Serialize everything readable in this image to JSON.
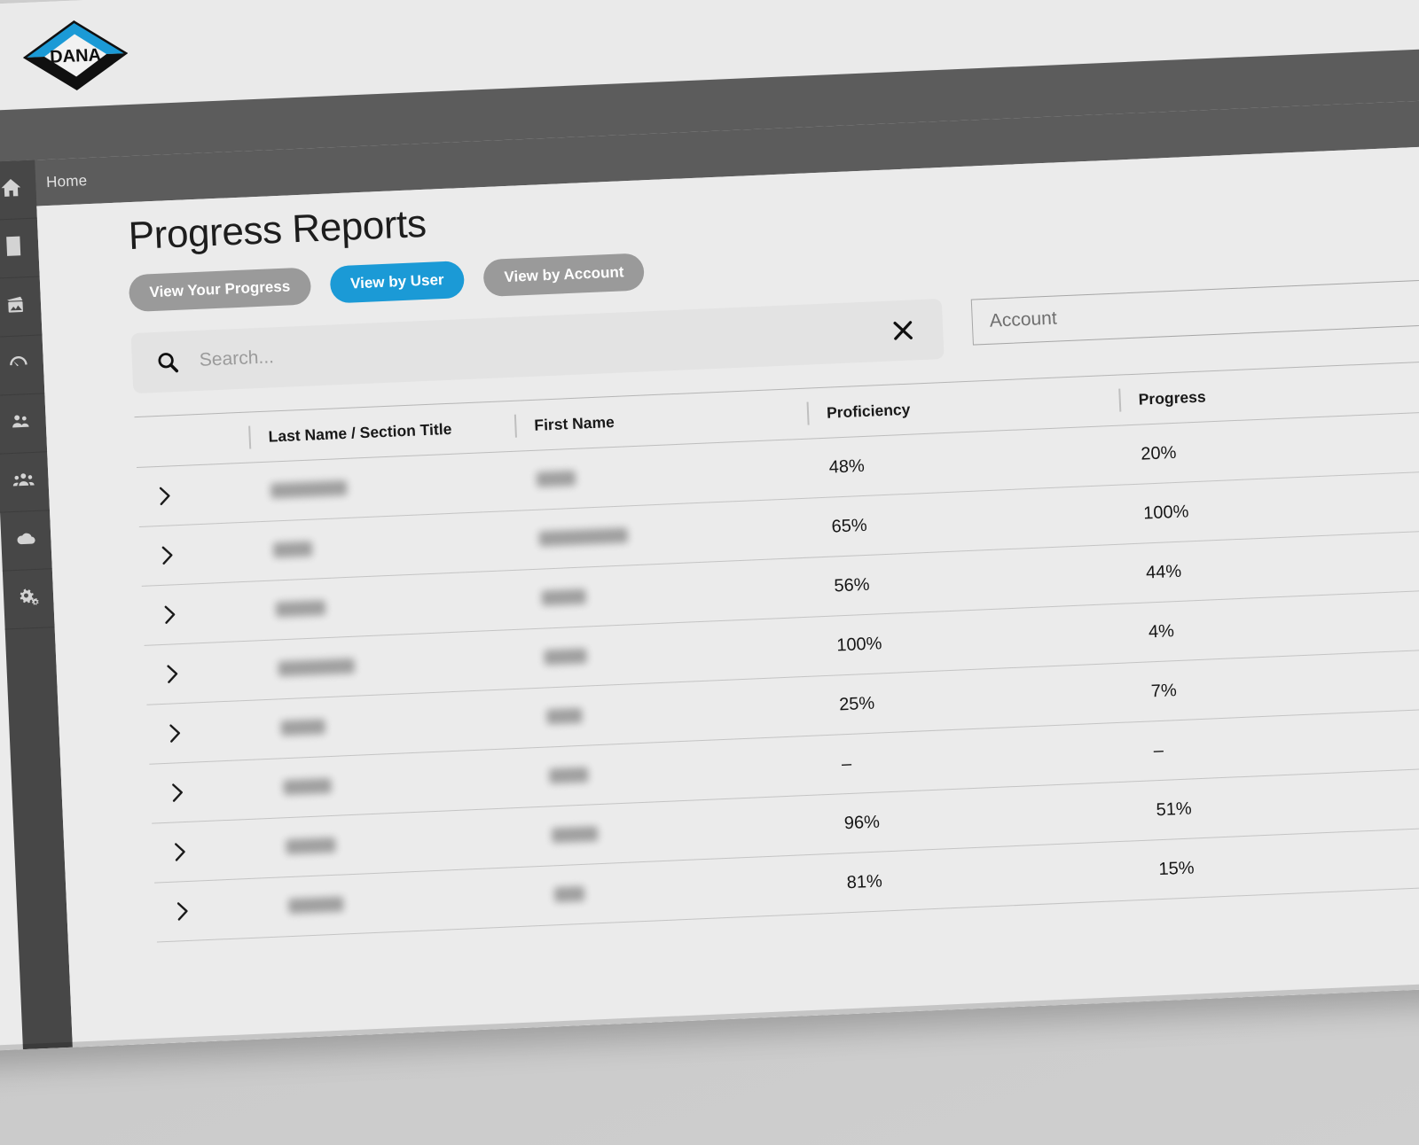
{
  "brand": {
    "logo_text": "DANA",
    "logo_top_color": "#1b9ad6",
    "logo_bottom_color": "#101010"
  },
  "topbar": {
    "menu_icon": "hamburger-icon",
    "breadcrumb": "Home"
  },
  "sidebar": {
    "items": [
      {
        "icon": "home-icon",
        "label": "Home"
      },
      {
        "icon": "book-icon",
        "label": "Courses"
      },
      {
        "icon": "media-icon",
        "label": "Media"
      },
      {
        "icon": "gauge-icon",
        "label": "Reports"
      },
      {
        "icon": "user-pair-icon",
        "label": "Users"
      },
      {
        "icon": "user-group-icon",
        "label": "Groups"
      },
      {
        "icon": "cloud-icon",
        "label": "Cloud"
      },
      {
        "icon": "gears-icon",
        "label": "Settings"
      }
    ]
  },
  "main": {
    "title": "Progress Reports",
    "tabs": [
      {
        "label": "View Your Progress",
        "active": false
      },
      {
        "label": "View by User",
        "active": true
      },
      {
        "label": "View by Account",
        "active": false
      }
    ],
    "accent_color": "#1b9ad6",
    "inactive_tab_color": "#9a9a9a",
    "search": {
      "placeholder": "Search...",
      "value": "",
      "icon": "search-icon",
      "clear_icon": "close-icon"
    },
    "account_filter": {
      "placeholder": "Account",
      "value": ""
    },
    "table": {
      "columns": [
        "Last Name / Section Title",
        "First Name",
        "Proficiency",
        "Progress"
      ],
      "expander_icon": "chevron-right-icon",
      "rows": [
        {
          "last_name": "",
          "first_name": "",
          "proficiency": "48%",
          "progress": "20%",
          "last_w": 86,
          "first_w": 44
        },
        {
          "last_name": "",
          "first_name": "",
          "proficiency": "65%",
          "progress": "100%",
          "last_w": 44,
          "first_w": 100
        },
        {
          "last_name": "",
          "first_name": "",
          "proficiency": "56%",
          "progress": "44%",
          "last_w": 56,
          "first_w": 50
        },
        {
          "last_name": "",
          "first_name": "",
          "proficiency": "100%",
          "progress": "4%",
          "last_w": 86,
          "first_w": 48
        },
        {
          "last_name": "",
          "first_name": "",
          "proficiency": "25%",
          "progress": "7%",
          "last_w": 50,
          "first_w": 40
        },
        {
          "last_name": "",
          "first_name": "",
          "proficiency": "–",
          "progress": "–",
          "last_w": 54,
          "first_w": 44
        },
        {
          "last_name": "",
          "first_name": "",
          "proficiency": "96%",
          "progress": "51%",
          "last_w": 56,
          "first_w": 52
        },
        {
          "last_name": "",
          "first_name": "",
          "proficiency": "81%",
          "progress": "15%",
          "last_w": 62,
          "first_w": 34
        }
      ]
    }
  }
}
